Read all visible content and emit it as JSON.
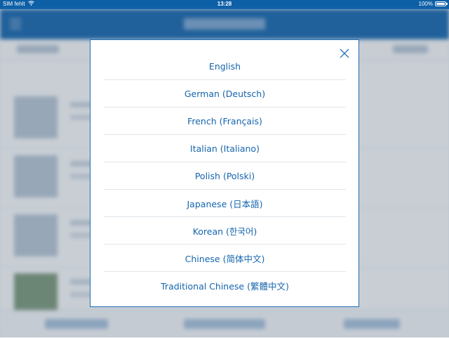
{
  "status_bar": {
    "carrier": "SIM fehlt",
    "wifi_icon": "wifi-icon",
    "time": "13:28",
    "battery_percent": "100%",
    "battery_icon": "battery-icon",
    "background_color": "#0d5fa6"
  },
  "language_dialog": {
    "close_icon": "close-icon",
    "accent_color": "#1565ad",
    "languages": [
      {
        "label": "English"
      },
      {
        "label": "German (Deutsch)"
      },
      {
        "label": "French (Français)"
      },
      {
        "label": "Italian (Italiano)"
      },
      {
        "label": "Polish (Polski)"
      },
      {
        "label": "Japanese (日本語)"
      },
      {
        "label": "Korean (한국어)"
      },
      {
        "label": "Chinese (简体中文)"
      },
      {
        "label": "Traditional Chinese (繁體中文)"
      }
    ]
  }
}
